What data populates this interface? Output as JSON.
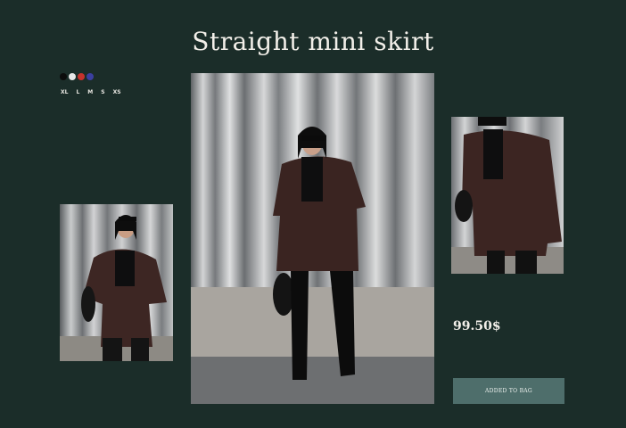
{
  "product": {
    "title": "Straight mini skirt",
    "price": "99.50$",
    "add_button_label": "ADDED TO BAG",
    "colors": [
      {
        "name": "black",
        "hex": "#0c0c0c"
      },
      {
        "name": "white",
        "hex": "#e8e8e8"
      },
      {
        "name": "red",
        "hex": "#c6322c"
      },
      {
        "name": "blue",
        "hex": "#3b3fa0"
      }
    ],
    "sizes": [
      "XL",
      "L",
      "M",
      "S",
      "XS"
    ]
  },
  "images": {
    "left": "model-photo-side",
    "center": "model-photo-main",
    "right": "model-photo-closeup"
  }
}
